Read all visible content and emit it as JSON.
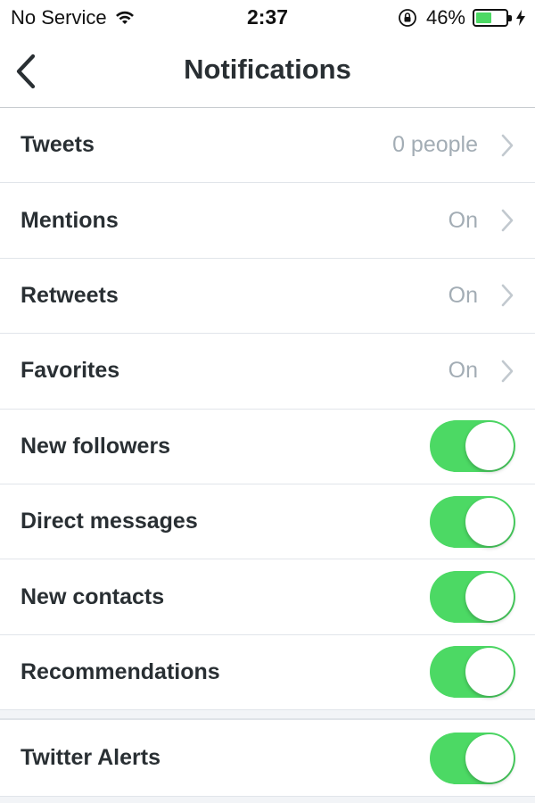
{
  "status_bar": {
    "carrier": "No Service",
    "time": "2:37",
    "battery_percent": "46%",
    "battery_level": 0.46,
    "icons": [
      "wifi-icon",
      "rotation-lock-icon",
      "battery-icon",
      "charging-bolt-icon"
    ]
  },
  "nav": {
    "title": "Notifications",
    "back_icon": "chevron-left-icon"
  },
  "rows": [
    {
      "label": "Tweets",
      "value": "0 people",
      "type": "disclosure"
    },
    {
      "label": "Mentions",
      "value": "On",
      "type": "disclosure"
    },
    {
      "label": "Retweets",
      "value": "On",
      "type": "disclosure"
    },
    {
      "label": "Favorites",
      "value": "On",
      "type": "disclosure"
    },
    {
      "label": "New followers",
      "type": "toggle",
      "on": true
    },
    {
      "label": "Direct messages",
      "type": "toggle",
      "on": true
    },
    {
      "label": "New contacts",
      "type": "toggle",
      "on": true
    },
    {
      "label": "Recommendations",
      "type": "toggle",
      "on": true
    }
  ],
  "rows2": [
    {
      "label": "Twitter Alerts",
      "type": "toggle",
      "on": true
    }
  ],
  "colors": {
    "toggle_on": "#4cd964",
    "text_primary": "#292f33",
    "text_secondary": "#a3adb5"
  }
}
